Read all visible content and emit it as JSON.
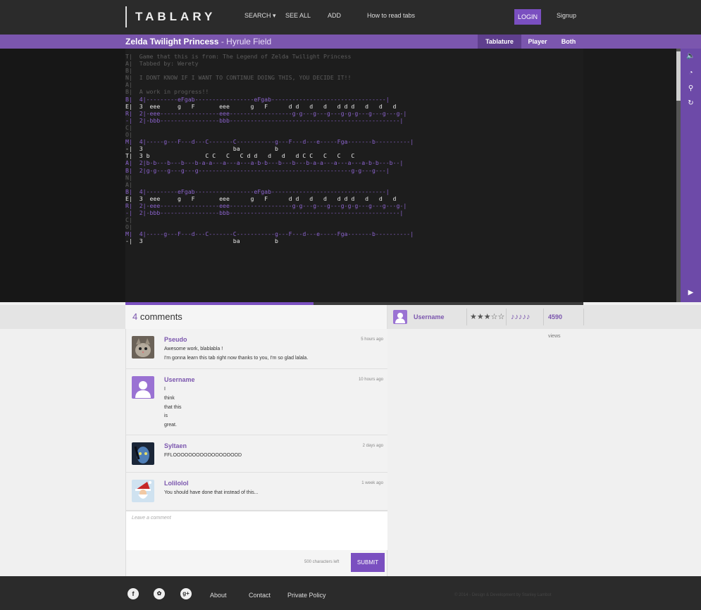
{
  "header": {
    "logo": "TABLARY",
    "nav": [
      "SEARCH ▾",
      "SEE ALL",
      "ADD",
      "How to read tabs"
    ],
    "login_label": "LOGIN",
    "signup_label": "Signup"
  },
  "song": {
    "title": "Zelda Twilight Princess",
    "separator": " - ",
    "subtitle": "Hyrule Field",
    "view_tabs": [
      "Tablature",
      "Player",
      "Both"
    ]
  },
  "tablature": {
    "lines": [
      {
        "t": "T|  Game that this is from: The Legend of Zelda Twilight Princess",
        "c": ""
      },
      {
        "t": "A|  Tabbed by: Werety",
        "c": ""
      },
      {
        "t": "B|",
        "c": ""
      },
      {
        "t": "N|  I DONT KNOW IF I WANT TO CONTINUE DOING THIS, YOU DECIDE IT!!",
        "c": ""
      },
      {
        "t": "A|",
        "c": ""
      },
      {
        "t": "B|  A work in progress!!",
        "c": ""
      },
      {
        "t": "B|  4|---------eFgab-----------------eFgab---------------------------------|",
        "c": "p"
      },
      {
        "t": "E|  3  eee     g   F       eee      g   F      d d   d   d   d d d   d   d   d",
        "c": "w"
      },
      {
        "t": "R|  2|-eee-----------------eee------------------g-g---g---g---g-g-g---g---g---g-|",
        "c": "p"
      },
      {
        "t": "-|  2|-bbb-----------------bbb-------------------------------------------------|",
        "c": "p"
      },
      {
        "t": "C|",
        "c": ""
      },
      {
        "t": "O|",
        "c": ""
      },
      {
        "t": "M|  4|-----g---F---d---C-------C-----------g---F---d---e-----Fga-------b----------|",
        "c": "p"
      },
      {
        "t": "-|  3                          ba          b",
        "c": "w"
      },
      {
        "t": "T|  3 b                C C   C   C d d   d   d   d C C   C   C   C",
        "c": "w"
      },
      {
        "t": "A|  2|b-b---b---b---b-a-a---a---a---a-b-b---b---b---b-a-a---a---a---a-b-b---b--|",
        "c": "p"
      },
      {
        "t": "B|  2|g-g---g---g---g--------------------------------------------g-g---g---|",
        "c": "p"
      },
      {
        "t": "N|",
        "c": ""
      },
      {
        "t": "A|",
        "c": ""
      },
      {
        "t": "B|  4|---------eFgab-----------------eFgab---------------------------------|",
        "c": "p"
      },
      {
        "t": "E|  3  eee     g   F       eee      g   F      d d   d   d   d d d   d   d   d",
        "c": "w"
      },
      {
        "t": "R|  2|-eee-----------------eee------------------g-g---g---g---g-g-g---g---g---g-|",
        "c": "p"
      },
      {
        "t": "-|  2|-bbb-----------------bbb-------------------------------------------------|",
        "c": "p"
      },
      {
        "t": "C|",
        "c": ""
      },
      {
        "t": "O|",
        "c": ""
      },
      {
        "t": "M|  4|-----g---F---d---C-------C-----------g---F---d---e-----Fga-------b----------|",
        "c": "p"
      },
      {
        "t": "-|  3                          ba          b",
        "c": "w"
      }
    ],
    "progress": 0.41
  },
  "comments_section": {
    "count": "4",
    "label": " comments",
    "author": {
      "name": "Username",
      "rating_stars": "★★★☆☆",
      "difficulty": "♪♪♪♪♪",
      "views": "4590",
      "views_label": " views"
    },
    "items": [
      {
        "name": "Pseudo",
        "time": "5 hours ago",
        "body": "Awesome work, blablabla !\nI'm gonna learn this tab right now thanks to you, I'm so glad lalala.",
        "avatar": "cat-avatar"
      },
      {
        "name": "Username",
        "time": "10 hours ago",
        "body": "I\nthink\nthat this\nis\ngreat.",
        "avatar": "default-avatar"
      },
      {
        "name": "Syltaen",
        "time": "2 days ago",
        "body": "FFLOOOOOOOOOOOOOOOOOD",
        "avatar": "avatar-blue"
      },
      {
        "name": "Lolilolol",
        "time": "1 week ago",
        "body": "You should have done that instead of this...",
        "avatar": "santa-avatar"
      }
    ],
    "compose_placeholder": "Leave a comment",
    "chars_left": "500 characters left",
    "submit_label": "SUBMIT"
  },
  "footer": {
    "links": [
      "About",
      "Contact",
      "Private Policy"
    ],
    "social": [
      "facebook-icon",
      "twitter-icon",
      "googleplus-icon"
    ],
    "copyright": "© 2014 - Design & Development by Stanley Lambot"
  },
  "colors": {
    "accent": "#7b56ae",
    "dark": "#2b2b2b"
  }
}
